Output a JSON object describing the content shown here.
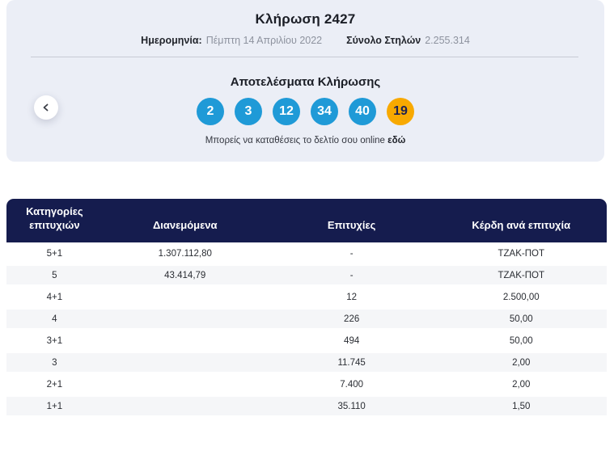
{
  "draw": {
    "title": "Κλήρωση 2427",
    "date_label": "Ημερομηνία:",
    "date_value": "Πέμπτη 14 Απριλίου 2022",
    "total_columns_label": "Σύνολο Στηλών",
    "total_columns_value": "2.255.314"
  },
  "results": {
    "title": "Αποτελέσματα Κλήρωσης",
    "numbers": [
      "2",
      "3",
      "12",
      "34",
      "40"
    ],
    "bonus_number": "19",
    "note_text": "Μπορείς να καταθέσεις το δελτίο σου online",
    "note_link_label": "εδώ"
  },
  "table": {
    "headers": [
      "Κατηγορίες επιτυχιών",
      "Διανεμόμενα",
      "Επιτυχίες",
      "Κέρδη ανά επιτυχία"
    ],
    "rows": [
      {
        "category": "5+1",
        "distributed": "1.307.112,80",
        "winners": "-",
        "prize": "ΤΖΑΚ-ΠΟΤ"
      },
      {
        "category": "5",
        "distributed": "43.414,79",
        "winners": "-",
        "prize": "ΤΖΑΚ-ΠΟΤ"
      },
      {
        "category": "4+1",
        "distributed": "",
        "winners": "12",
        "prize": "2.500,00"
      },
      {
        "category": "4",
        "distributed": "",
        "winners": "226",
        "prize": "50,00"
      },
      {
        "category": "3+1",
        "distributed": "",
        "winners": "494",
        "prize": "50,00"
      },
      {
        "category": "3",
        "distributed": "",
        "winners": "11.745",
        "prize": "2,00"
      },
      {
        "category": "2+1",
        "distributed": "",
        "winners": "7.400",
        "prize": "2,00"
      },
      {
        "category": "1+1",
        "distributed": "",
        "winners": "35.110",
        "prize": "1,50"
      }
    ]
  },
  "colors": {
    "card_background": "#ebeef6",
    "ball_blue": "#1f9ad7",
    "ball_bonus_orange": "#f8a900",
    "table_header_navy": "#151c4e",
    "row_stripe": "#f5f6f8",
    "muted_text": "#8d929e"
  }
}
